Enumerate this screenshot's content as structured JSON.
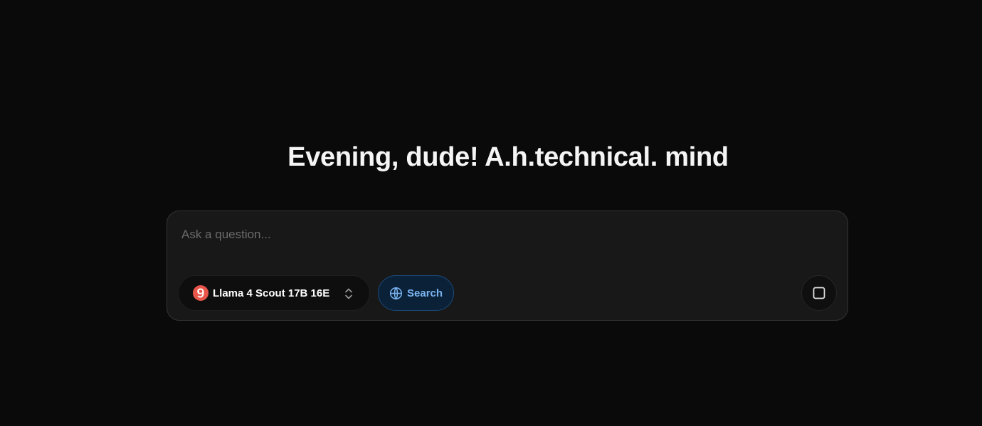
{
  "greeting": "Evening, dude! A.h.technical. mind",
  "composer": {
    "placeholder": "Ask a question...",
    "value": ""
  },
  "model_selector": {
    "label": "Llama 4 Scout 17B 16E",
    "logo_icon": "llama-logo-icon",
    "logo_color": "#e8554a",
    "chevron_icon": "chevron-up-down-icon"
  },
  "search_toggle": {
    "label": "Search",
    "icon": "globe-icon",
    "active": true,
    "accent_color": "#7ab4f0"
  },
  "stop_button": {
    "icon": "stop-square-icon"
  },
  "colors": {
    "background": "#0a0a0a",
    "composer_bg": "#181818",
    "search_bg": "#0b2138"
  }
}
